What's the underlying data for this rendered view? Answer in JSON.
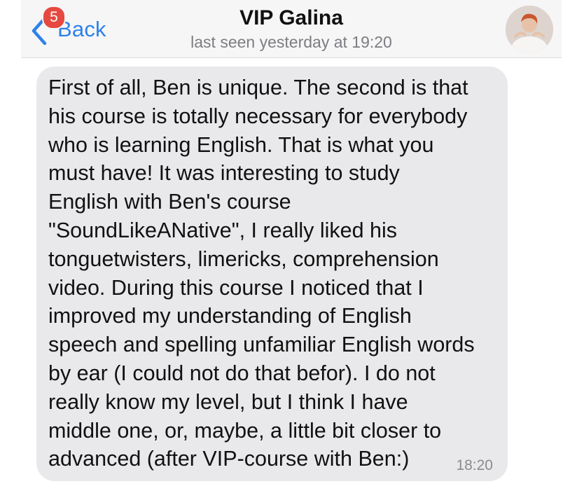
{
  "header": {
    "back_label": "Back",
    "unread_count": "5",
    "title": "VIP Galina",
    "status": "last seen yesterday at 19:20",
    "avatar_icon": "contact-avatar-icon"
  },
  "message": {
    "text": "First of all, Ben is unique. The second is that\nhis course is totally necessary for everybody\nwho is learning English. That is what you\nmust have! It was interesting to study\nEnglish with Ben's course\n\"SoundLikeANative\", I really liked his\ntonguetwisters, limericks, comprehension\nvideo. During this course I noticed that I\nimproved my understanding of English\nspeech and spelling unfamiliar English words\nby ear (I could not do that befor). I do not\nreally know my level, but I think I have\nmiddle one, or, maybe, a little bit closer to\nadvanced (after VIP-course with Ben:)",
    "time": "18:20"
  },
  "colors": {
    "accent": "#2f82e8",
    "badge": "#e5493f",
    "bubble": "#e9e9eb",
    "header_bg": "#f6f6f7"
  }
}
